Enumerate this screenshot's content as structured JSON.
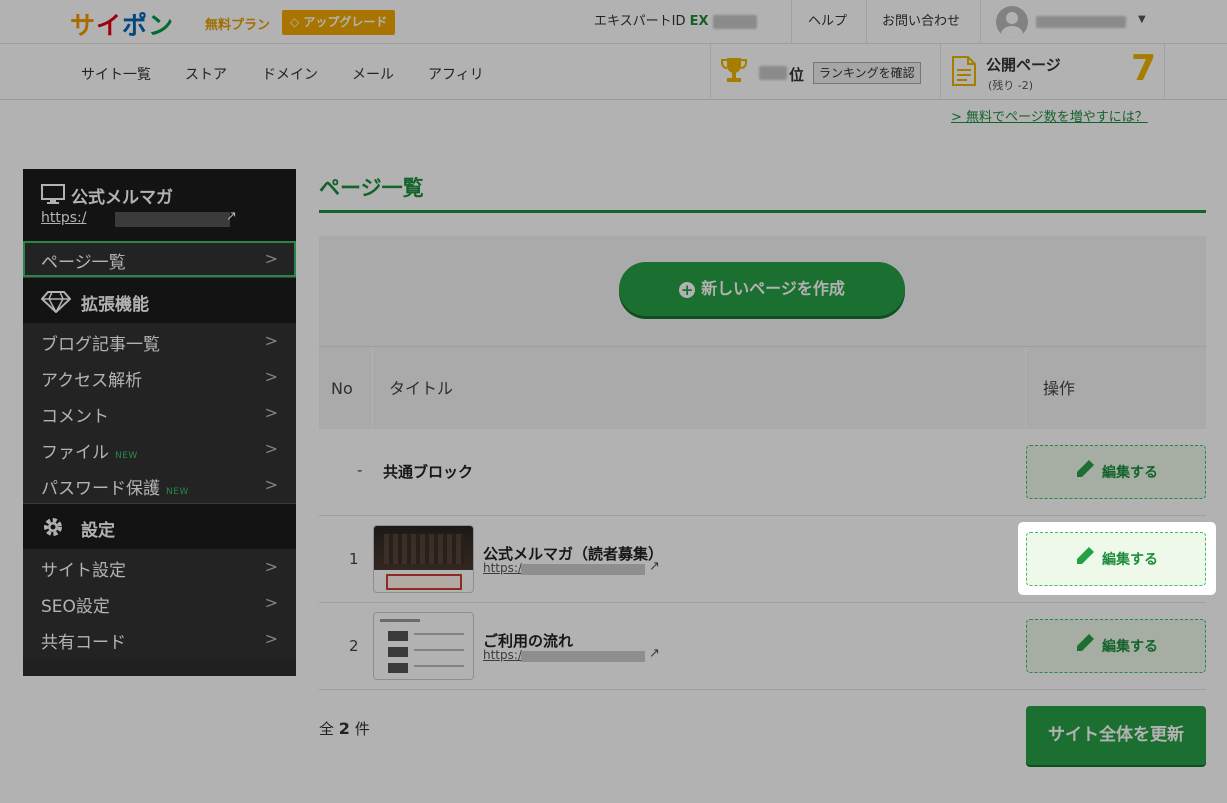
{
  "header": {
    "logo": [
      "サ",
      "イ",
      "ポ",
      "ン"
    ],
    "plan": "無料プラン",
    "upgrade": "アップグレード",
    "expert_id_label": "エキスパートID",
    "expert_id_prefix": "EX",
    "help": "ヘルプ",
    "contact": "お問い合わせ"
  },
  "subnav": {
    "items": [
      "サイト一覧",
      "ストア",
      "ドメイン",
      "メール",
      "アフィリ"
    ],
    "rank_suffix": "位",
    "rank_button": "ランキングを確認",
    "public_pages_title": "公開ページ",
    "public_pages_remaining": "(残り -2)",
    "public_pages_count": "7",
    "increase_link": "> 無料でページ数を増やすには？"
  },
  "sidebar": {
    "site_title": "公式メルマガ",
    "site_url_prefix": "https:/",
    "pages_item": "ページ一覧",
    "ext_section": "拡張機能",
    "ext_items": [
      {
        "label": "ブログ記事一覧",
        "badge": ""
      },
      {
        "label": "アクセス解析",
        "badge": ""
      },
      {
        "label": "コメント",
        "badge": ""
      },
      {
        "label": "ファイル",
        "badge": "NEW"
      },
      {
        "label": "パスワード保護",
        "badge": "NEW"
      }
    ],
    "settings_section": "設定",
    "settings_items": [
      "サイト設定",
      "SEO設定",
      "共有コード"
    ]
  },
  "main": {
    "title": "ページ一覧",
    "create_button": "新しいページを作成",
    "columns": {
      "no": "No",
      "title": "タイトル",
      "ops": "操作"
    },
    "rows": [
      {
        "no": "-",
        "title": "共通ブロック",
        "url_prefix": "",
        "edit": "編集する"
      },
      {
        "no": "1",
        "title": "公式メルマガ（読者募集）",
        "url_prefix": "https:/",
        "edit": "編集する"
      },
      {
        "no": "2",
        "title": "ご利用の流れ",
        "url_prefix": "https:/",
        "edit": "編集する"
      }
    ],
    "count_prefix": "全",
    "count_value": "2",
    "count_suffix": "件",
    "update_button": "サイト全体を更新"
  },
  "colors": {
    "brand_green": "#27a045",
    "accent_yellow": "#f0b400"
  }
}
